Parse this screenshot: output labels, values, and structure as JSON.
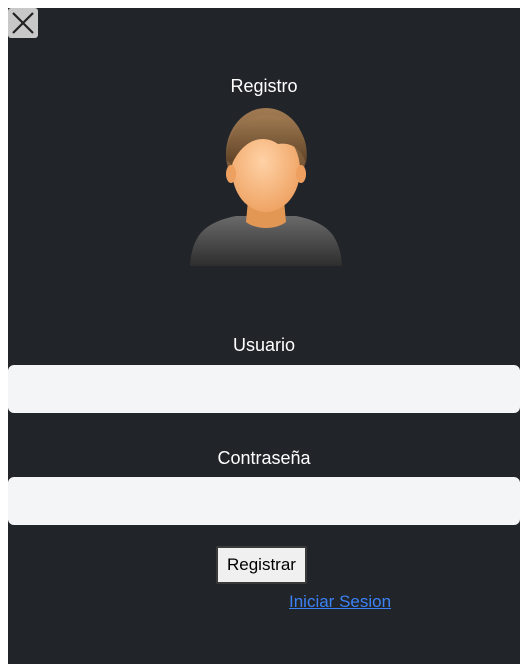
{
  "header": {
    "close_icon": "close-icon",
    "title": "Registro"
  },
  "avatar": {
    "icon": "user-avatar-icon"
  },
  "form": {
    "username_label": "Usuario",
    "username_value": "",
    "password_label": "Contraseña",
    "password_value": "",
    "submit_label": "Registrar",
    "login_link": "Iniciar Sesion"
  },
  "colors": {
    "background": "#212429",
    "input_background": "#f4f5f7",
    "link": "#3b82f6",
    "text": "#ffffff"
  }
}
